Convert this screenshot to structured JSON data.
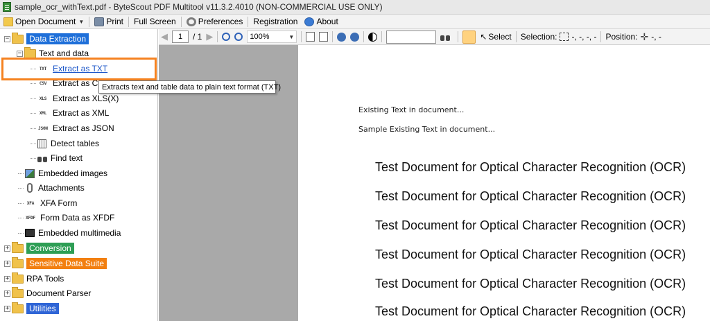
{
  "window": {
    "title": "sample_ocr_withText.pdf - ByteScout PDF Multitool v11.3.2.4010 (NON-COMMERCIAL USE ONLY)"
  },
  "menubar": {
    "open_document": "Open Document",
    "print": "Print",
    "full_screen": "Full Screen",
    "preferences": "Preferences",
    "registration": "Registration",
    "about": "About"
  },
  "tree": {
    "data_extraction": "Data Extraction",
    "text_and_data": "Text and data",
    "extract_txt": "Extract as TXT",
    "extract_csv": "Extract as CSV",
    "extract_xls": "Extract as XLS(X)",
    "extract_xml": "Extract as XML",
    "extract_json": "Extract as JSON",
    "detect_tables": "Detect tables",
    "find_text": "Find text",
    "embedded_images": "Embedded images",
    "attachments": "Attachments",
    "xfa_form": "XFA Form",
    "form_data_xfdf": "Form Data as XFDF",
    "embedded_multimedia": "Embedded multimedia",
    "conversion": "Conversion",
    "sensitive_data": "Sensitive Data Suite",
    "rpa_tools": "RPA Tools",
    "document_parser": "Document Parser",
    "utilities": "Utilities",
    "icon_labels": {
      "txt": "TXT",
      "csv": "CSV",
      "xls": "XLS",
      "xml": "XML",
      "json": "JSON",
      "xfa": "XFA",
      "xfdf": "XFDF"
    }
  },
  "tooltip": "Extracts text and table data to plain text format (TXT)",
  "viewer": {
    "page_current": "1",
    "page_total": "/ 1",
    "zoom": "100%",
    "search_value": "",
    "select_label": "Select",
    "selection_label": "Selection:",
    "selection_value": "-, -, -, -",
    "position_label": "Position:",
    "position_value": "-, -"
  },
  "document": {
    "existing_text_1": "Existing Text in document...",
    "existing_text_2": "Sample Existing Text in document...",
    "ocr_lines": [
      "Test Document for Optical Character Recognition (OCR)",
      "Test Document for Optical Character Recognition (OCR)",
      "Test Document for Optical Character Recognition (OCR)",
      "Test Document for Optical Character Recognition (OCR)",
      "Test Document for Optical Character Recognition (OCR)",
      "Test Document for Optical Character Recognition (OCR)"
    ]
  },
  "colors": {
    "highlight": "#f58220",
    "data_extraction": "#1e6fd9",
    "conversion": "#2e9e55",
    "sensitive_data": "#f27f10",
    "utilities": "#2f65d6"
  }
}
